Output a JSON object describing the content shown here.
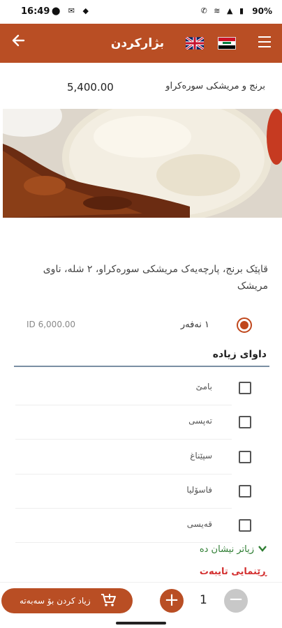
{
  "status": {
    "time": "16:49",
    "battery": "90%"
  },
  "header": {
    "title": "بژارکردن"
  },
  "product": {
    "name": "برنج و مریشکی سورەکراو",
    "price": "5,400.00",
    "description": "قاپێک برنج، پارچەیەک مریشکی سورەکراو، ٢ شلە، ناوی مریشک"
  },
  "option": {
    "label": "١ نەفەر",
    "price": "ID 6,000.00",
    "selected": true
  },
  "extras": {
    "title": "داوای زیادە",
    "items": [
      {
        "label": "بامێ"
      },
      {
        "label": "تەپسی"
      },
      {
        "label": "سپێناغ"
      },
      {
        "label": "فاسۆلیا"
      },
      {
        "label": "قەیسی"
      }
    ],
    "show_more": "زیاتر نیشان دە",
    "special_instructions": "ڕێنمایی تایبەت"
  },
  "cart": {
    "add_label": "زیاد کردن بۆ سەبەتە",
    "quantity": "1"
  },
  "colors": {
    "brand": "#b94e24",
    "accent_green": "#2e7d32",
    "accent_red": "#d32f2f"
  }
}
